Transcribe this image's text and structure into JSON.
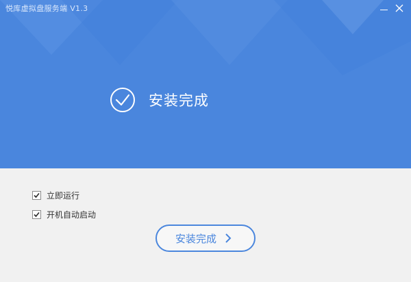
{
  "window": {
    "title": "悦库虚拟盘服务端 V1.3",
    "header_color": "#4a86dd"
  },
  "status": {
    "text": "安装完成",
    "icon": "check-circle-icon"
  },
  "options": [
    {
      "label": "立即运行",
      "checked": true
    },
    {
      "label": "开机自动启动",
      "checked": true
    }
  ],
  "actions": {
    "finish_label": "安装完成",
    "finish_icon": "chevron-right-icon",
    "accent": "#4a86dd"
  }
}
